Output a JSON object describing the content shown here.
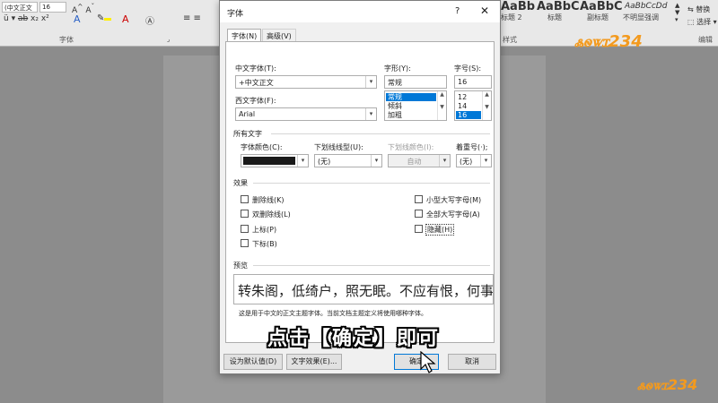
{
  "ribbon": {
    "font_name": "(中文正文",
    "font_size": "16",
    "font_group_label": "字体",
    "styles_group_label": "样式",
    "edit_group_label": "编辑",
    "styles": [
      {
        "sample": "AaBb",
        "name": "标题 2"
      },
      {
        "sample": "AaBbC",
        "name": "标题"
      },
      {
        "sample": "AaBbC",
        "name": "副标题"
      },
      {
        "sample": "AaBbCcDd",
        "name": "不明显强调"
      }
    ],
    "replace_label": "替换",
    "select_label": "选择"
  },
  "watermark": {
    "text": "ꮬꮻꮤꮖ234"
  },
  "dialog": {
    "title": "字体",
    "help": "?",
    "close": "✕",
    "tabs": [
      {
        "label": "字体(N)",
        "active": true
      },
      {
        "label": "高级(V)",
        "active": false
      }
    ],
    "chinese_font": {
      "label": "中文字体(T):",
      "value": "+中文正文"
    },
    "western_font": {
      "label": "西文字体(F):",
      "value": "Arial"
    },
    "font_style": {
      "label": "字形(Y):",
      "value": "常规",
      "options": [
        {
          "label": "常规",
          "selected": true
        },
        {
          "label": "倾斜",
          "selected": false
        },
        {
          "label": "加粗",
          "selected": false
        }
      ]
    },
    "font_size": {
      "label": "字号(S):",
      "value": "16",
      "options": [
        {
          "label": "12",
          "selected": false
        },
        {
          "label": "14",
          "selected": false
        },
        {
          "label": "16",
          "selected": true
        }
      ]
    },
    "all_text": {
      "section": "所有文字",
      "font_color": {
        "label": "字体颜色(C):",
        "color": "#1a1a1a"
      },
      "underline_style": {
        "label": "下划线线型(U):",
        "value": "(无)"
      },
      "underline_color": {
        "label": "下划线颜色(I):",
        "value": "自动"
      },
      "emphasis": {
        "label": "着重号(·);",
        "value": "(无)"
      }
    },
    "effects": {
      "section": "效果",
      "left": [
        "删除线(K)",
        "双删除线(L)",
        "上标(P)",
        "下标(B)"
      ],
      "right": [
        "小型大写字母(M)",
        "全部大写字母(A)",
        "隐藏(H)"
      ]
    },
    "preview": {
      "section": "预览",
      "text": "转朱阁，低绮户，照无眠。不应有恨，何事长",
      "note": "这是用于中文的正文主题字体。当前文档主题定义将使用哪种字体。"
    },
    "buttons": {
      "set_default": "设为默认值(D)",
      "text_effects": "文字效果(E)...",
      "ok": "确定",
      "cancel": "取消"
    }
  },
  "caption": "点击【确定】即可",
  "colors": {
    "accent": "#0078d7",
    "logo_orange": "#f39a1e",
    "logo_green": "#7cc242"
  }
}
